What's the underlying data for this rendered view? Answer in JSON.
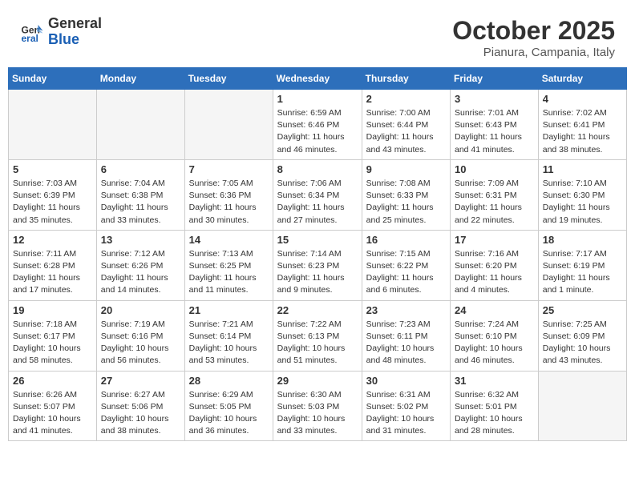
{
  "header": {
    "logo_line1": "General",
    "logo_line2": "Blue",
    "month": "October 2025",
    "location": "Pianura, Campania, Italy"
  },
  "days_of_week": [
    "Sunday",
    "Monday",
    "Tuesday",
    "Wednesday",
    "Thursday",
    "Friday",
    "Saturday"
  ],
  "weeks": [
    [
      {
        "day": "",
        "info": ""
      },
      {
        "day": "",
        "info": ""
      },
      {
        "day": "",
        "info": ""
      },
      {
        "day": "1",
        "info": "Sunrise: 6:59 AM\nSunset: 6:46 PM\nDaylight: 11 hours\nand 46 minutes."
      },
      {
        "day": "2",
        "info": "Sunrise: 7:00 AM\nSunset: 6:44 PM\nDaylight: 11 hours\nand 43 minutes."
      },
      {
        "day": "3",
        "info": "Sunrise: 7:01 AM\nSunset: 6:43 PM\nDaylight: 11 hours\nand 41 minutes."
      },
      {
        "day": "4",
        "info": "Sunrise: 7:02 AM\nSunset: 6:41 PM\nDaylight: 11 hours\nand 38 minutes."
      }
    ],
    [
      {
        "day": "5",
        "info": "Sunrise: 7:03 AM\nSunset: 6:39 PM\nDaylight: 11 hours\nand 35 minutes."
      },
      {
        "day": "6",
        "info": "Sunrise: 7:04 AM\nSunset: 6:38 PM\nDaylight: 11 hours\nand 33 minutes."
      },
      {
        "day": "7",
        "info": "Sunrise: 7:05 AM\nSunset: 6:36 PM\nDaylight: 11 hours\nand 30 minutes."
      },
      {
        "day": "8",
        "info": "Sunrise: 7:06 AM\nSunset: 6:34 PM\nDaylight: 11 hours\nand 27 minutes."
      },
      {
        "day": "9",
        "info": "Sunrise: 7:08 AM\nSunset: 6:33 PM\nDaylight: 11 hours\nand 25 minutes."
      },
      {
        "day": "10",
        "info": "Sunrise: 7:09 AM\nSunset: 6:31 PM\nDaylight: 11 hours\nand 22 minutes."
      },
      {
        "day": "11",
        "info": "Sunrise: 7:10 AM\nSunset: 6:30 PM\nDaylight: 11 hours\nand 19 minutes."
      }
    ],
    [
      {
        "day": "12",
        "info": "Sunrise: 7:11 AM\nSunset: 6:28 PM\nDaylight: 11 hours\nand 17 minutes."
      },
      {
        "day": "13",
        "info": "Sunrise: 7:12 AM\nSunset: 6:26 PM\nDaylight: 11 hours\nand 14 minutes."
      },
      {
        "day": "14",
        "info": "Sunrise: 7:13 AM\nSunset: 6:25 PM\nDaylight: 11 hours\nand 11 minutes."
      },
      {
        "day": "15",
        "info": "Sunrise: 7:14 AM\nSunset: 6:23 PM\nDaylight: 11 hours\nand 9 minutes."
      },
      {
        "day": "16",
        "info": "Sunrise: 7:15 AM\nSunset: 6:22 PM\nDaylight: 11 hours\nand 6 minutes."
      },
      {
        "day": "17",
        "info": "Sunrise: 7:16 AM\nSunset: 6:20 PM\nDaylight: 11 hours\nand 4 minutes."
      },
      {
        "day": "18",
        "info": "Sunrise: 7:17 AM\nSunset: 6:19 PM\nDaylight: 11 hours\nand 1 minute."
      }
    ],
    [
      {
        "day": "19",
        "info": "Sunrise: 7:18 AM\nSunset: 6:17 PM\nDaylight: 10 hours\nand 58 minutes."
      },
      {
        "day": "20",
        "info": "Sunrise: 7:19 AM\nSunset: 6:16 PM\nDaylight: 10 hours\nand 56 minutes."
      },
      {
        "day": "21",
        "info": "Sunrise: 7:21 AM\nSunset: 6:14 PM\nDaylight: 10 hours\nand 53 minutes."
      },
      {
        "day": "22",
        "info": "Sunrise: 7:22 AM\nSunset: 6:13 PM\nDaylight: 10 hours\nand 51 minutes."
      },
      {
        "day": "23",
        "info": "Sunrise: 7:23 AM\nSunset: 6:11 PM\nDaylight: 10 hours\nand 48 minutes."
      },
      {
        "day": "24",
        "info": "Sunrise: 7:24 AM\nSunset: 6:10 PM\nDaylight: 10 hours\nand 46 minutes."
      },
      {
        "day": "25",
        "info": "Sunrise: 7:25 AM\nSunset: 6:09 PM\nDaylight: 10 hours\nand 43 minutes."
      }
    ],
    [
      {
        "day": "26",
        "info": "Sunrise: 6:26 AM\nSunset: 5:07 PM\nDaylight: 10 hours\nand 41 minutes."
      },
      {
        "day": "27",
        "info": "Sunrise: 6:27 AM\nSunset: 5:06 PM\nDaylight: 10 hours\nand 38 minutes."
      },
      {
        "day": "28",
        "info": "Sunrise: 6:29 AM\nSunset: 5:05 PM\nDaylight: 10 hours\nand 36 minutes."
      },
      {
        "day": "29",
        "info": "Sunrise: 6:30 AM\nSunset: 5:03 PM\nDaylight: 10 hours\nand 33 minutes."
      },
      {
        "day": "30",
        "info": "Sunrise: 6:31 AM\nSunset: 5:02 PM\nDaylight: 10 hours\nand 31 minutes."
      },
      {
        "day": "31",
        "info": "Sunrise: 6:32 AM\nSunset: 5:01 PM\nDaylight: 10 hours\nand 28 minutes."
      },
      {
        "day": "",
        "info": ""
      }
    ]
  ]
}
